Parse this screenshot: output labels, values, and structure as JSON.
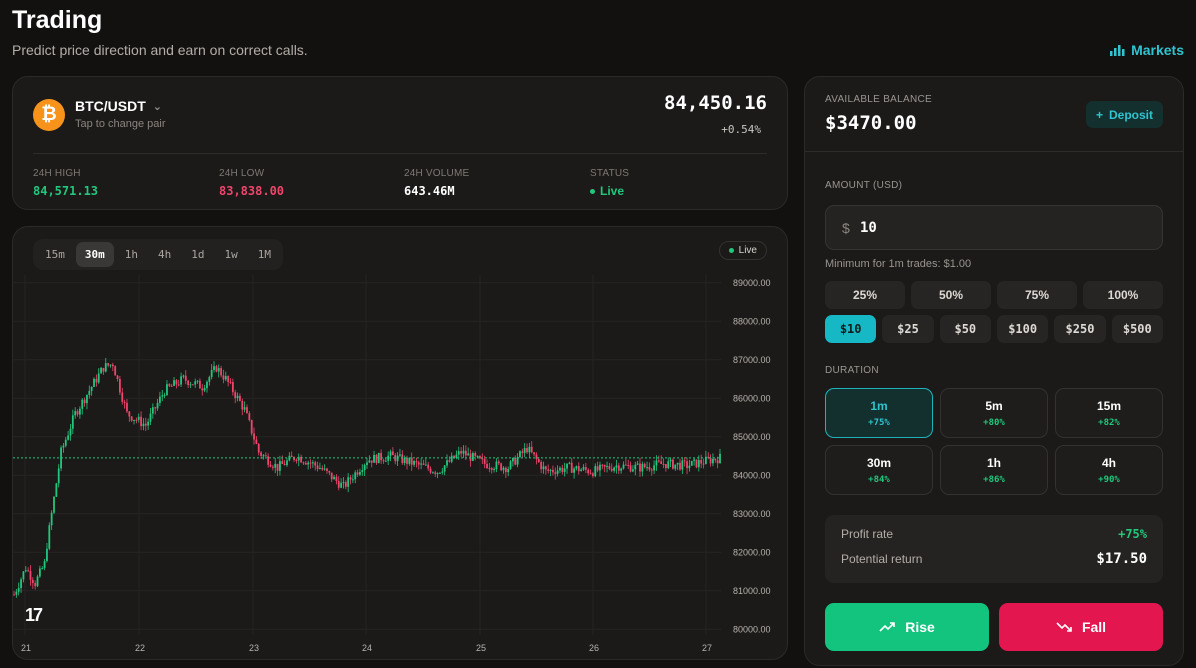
{
  "header": {
    "title": "Trading",
    "subtitle": "Predict price direction and earn on correct calls.",
    "markets_link": "Markets"
  },
  "pair": {
    "coin_symbol": "₿",
    "name": "BTC/USDT",
    "hint": "Tap to change pair",
    "price": "84,450.16",
    "change": "+0.54%",
    "stats": [
      {
        "label": "24H HIGH",
        "value": "84,571.13",
        "tone": "green"
      },
      {
        "label": "24H LOW",
        "value": "83,838.00",
        "tone": "red"
      },
      {
        "label": "24H VOLUME",
        "value": "643.46M",
        "tone": "white"
      },
      {
        "label": "STATUS",
        "value": "Live",
        "tone": "green"
      }
    ]
  },
  "chart": {
    "timeframes": [
      "15m",
      "30m",
      "1h",
      "4h",
      "1d",
      "1w",
      "1M"
    ],
    "active_timeframe": "30m",
    "live_label": "Live",
    "watermark": "17"
  },
  "chart_data": {
    "type": "candlestick",
    "x_ticks": [
      "21",
      "22",
      "23",
      "24",
      "25",
      "26",
      "27"
    ],
    "y_ticks": [
      "89000.00",
      "88000.00",
      "87000.00",
      "86000.00",
      "85000.00",
      "84000.00",
      "83000.00",
      "82000.00",
      "81000.00",
      "80000.00"
    ],
    "ylim": [
      79850,
      89200
    ],
    "last_price": 84450.16,
    "up_color": "#22c77c",
    "down_color": "#f0456b",
    "trend_points": [
      [
        0,
        80900
      ],
      [
        5,
        81600
      ],
      [
        9,
        81200
      ],
      [
        13,
        81700
      ],
      [
        14,
        82200
      ],
      [
        20,
        84600
      ],
      [
        26,
        85600
      ],
      [
        32,
        86200
      ],
      [
        38,
        86800
      ],
      [
        42,
        86900
      ],
      [
        48,
        85600
      ],
      [
        56,
        85300
      ],
      [
        64,
        86200
      ],
      [
        72,
        86500
      ],
      [
        80,
        86300
      ],
      [
        86,
        86800
      ],
      [
        90,
        86500
      ],
      [
        98,
        85700
      ],
      [
        104,
        84600
      ],
      [
        112,
        84200
      ],
      [
        120,
        84500
      ],
      [
        130,
        84200
      ],
      [
        140,
        83700
      ],
      [
        150,
        84400
      ],
      [
        160,
        84500
      ],
      [
        170,
        84300
      ],
      [
        180,
        84100
      ],
      [
        190,
        84600
      ],
      [
        200,
        84300
      ],
      [
        210,
        84200
      ],
      [
        218,
        84700
      ],
      [
        226,
        84100
      ],
      [
        236,
        84200
      ],
      [
        246,
        84100
      ],
      [
        256,
        84250
      ],
      [
        266,
        84200
      ],
      [
        276,
        84300
      ],
      [
        286,
        84250
      ],
      [
        296,
        84400
      ],
      [
        300,
        84450
      ]
    ]
  },
  "trade": {
    "balance_label": "AVAILABLE BALANCE",
    "balance": "$3470.00",
    "deposit_label": "Deposit",
    "amount_label": "AMOUNT (USD)",
    "currency_symbol": "$",
    "amount_value": "10",
    "min_note": "Minimum for 1m trades: $1.00",
    "percent_buttons": [
      "25%",
      "50%",
      "75%",
      "100%"
    ],
    "amount_buttons": [
      "$10",
      "$25",
      "$50",
      "$100",
      "$250",
      "$500"
    ],
    "duration_label": "DURATION",
    "durations": [
      {
        "label": "1m",
        "pct": "+75%"
      },
      {
        "label": "5m",
        "pct": "+80%"
      },
      {
        "label": "15m",
        "pct": "+82%"
      },
      {
        "label": "30m",
        "pct": "+84%"
      },
      {
        "label": "1h",
        "pct": "+86%"
      },
      {
        "label": "4h",
        "pct": "+90%"
      }
    ],
    "profit_label": "Profit rate",
    "profit_value": "+75%",
    "return_label": "Potential return",
    "return_value": "$17.50",
    "rise_label": "Rise",
    "fall_label": "Fall"
  }
}
